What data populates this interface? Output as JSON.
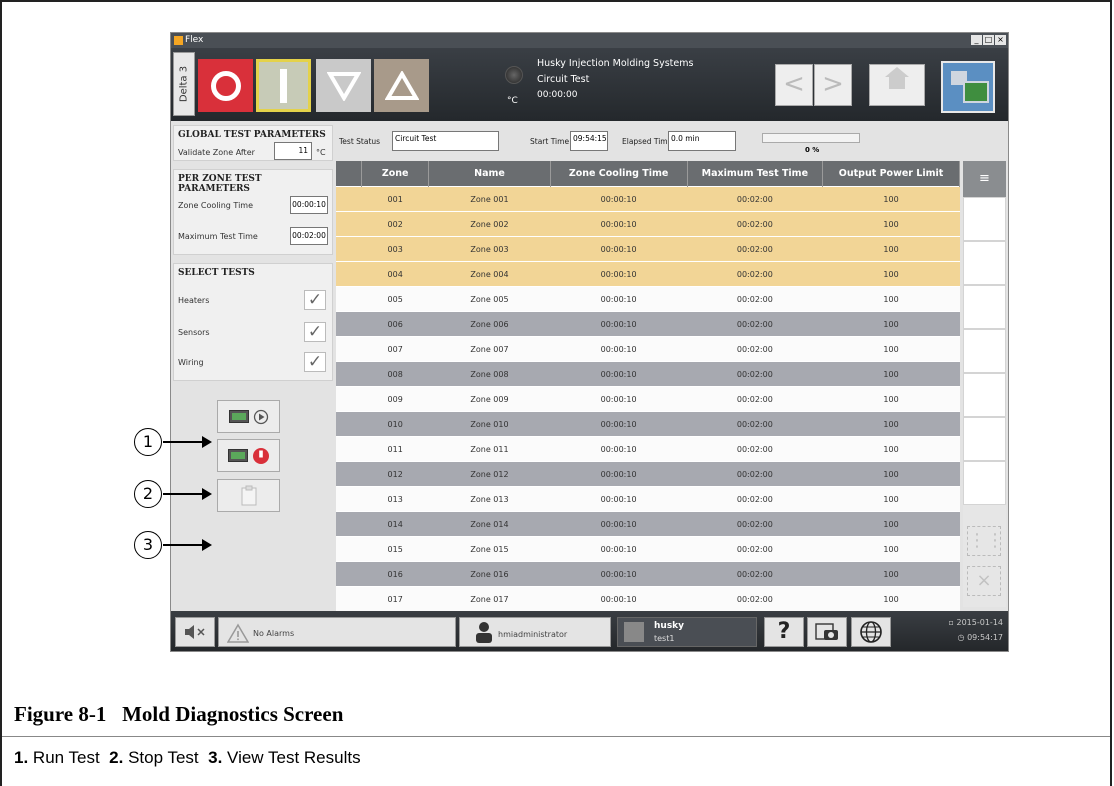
{
  "window": {
    "title": "Flex",
    "controls": [
      "_",
      "□",
      "×"
    ]
  },
  "toolbar": {
    "side_label": "Delta 3",
    "info": {
      "line1": "Husky Injection Molding Systems",
      "line2": "Circuit Test",
      "line3": "00:00:00",
      "temp_unit": "°C"
    },
    "nav_prev": "<",
    "nav_next": ">"
  },
  "global": {
    "title": "GLOBAL TEST PARAMETERS",
    "validate_label": "Validate Zone After",
    "validate_value": "11",
    "validate_unit": "°C"
  },
  "per_zone": {
    "title": "PER ZONE TEST PARAMETERS",
    "cooling_label": "Zone Cooling Time",
    "cooling_value": "00:00:10",
    "max_label": "Maximum Test Time",
    "max_value": "00:02:00"
  },
  "select_tests": {
    "title": "SELECT TESTS",
    "heaters": "Heaters",
    "sensors": "Sensors",
    "wiring": "Wiring",
    "check_glyph": "✓"
  },
  "status": {
    "test_status_label": "Test Status",
    "test_status_value": "Circuit Test",
    "start_label": "Start Time",
    "start_value": "09:54:15",
    "elapsed_label": "Elapsed Time",
    "elapsed_value": "0.0 min",
    "progress_text": "0 %",
    "progress_fraction": 0
  },
  "table": {
    "headers": [
      "Zone",
      "Name",
      "Zone Cooling Time",
      "Maximum Test Time",
      "Output Power Limit"
    ],
    "rows": [
      [
        "001",
        "Zone 001",
        "00:00:10",
        "00:02:00",
        "100"
      ],
      [
        "002",
        "Zone 002",
        "00:00:10",
        "00:02:00",
        "100"
      ],
      [
        "003",
        "Zone 003",
        "00:00:10",
        "00:02:00",
        "100"
      ],
      [
        "004",
        "Zone 004",
        "00:00:10",
        "00:02:00",
        "100"
      ],
      [
        "005",
        "Zone 005",
        "00:00:10",
        "00:02:00",
        "100"
      ],
      [
        "006",
        "Zone 006",
        "00:00:10",
        "00:02:00",
        "100"
      ],
      [
        "007",
        "Zone 007",
        "00:00:10",
        "00:02:00",
        "100"
      ],
      [
        "008",
        "Zone 008",
        "00:00:10",
        "00:02:00",
        "100"
      ],
      [
        "009",
        "Zone 009",
        "00:00:10",
        "00:02:00",
        "100"
      ],
      [
        "010",
        "Zone 010",
        "00:00:10",
        "00:02:00",
        "100"
      ],
      [
        "011",
        "Zone 011",
        "00:00:10",
        "00:02:00",
        "100"
      ],
      [
        "012",
        "Zone 012",
        "00:00:10",
        "00:02:00",
        "100"
      ],
      [
        "013",
        "Zone 013",
        "00:00:10",
        "00:02:00",
        "100"
      ],
      [
        "014",
        "Zone 014",
        "00:00:10",
        "00:02:00",
        "100"
      ],
      [
        "015",
        "Zone 015",
        "00:00:10",
        "00:02:00",
        "100"
      ],
      [
        "016",
        "Zone 016",
        "00:00:10",
        "00:02:00",
        "100"
      ],
      [
        "017",
        "Zone 017",
        "00:00:10",
        "00:02:00",
        "100"
      ]
    ],
    "menu_glyph": "≡"
  },
  "footer": {
    "alarms": "No Alarms",
    "user": "hmiadministrator",
    "mold_name": "husky",
    "mold_sub": "test1",
    "help": "?",
    "date": "2015-01-14",
    "time": "09:54:17"
  },
  "callouts": [
    "1",
    "2",
    "3"
  ],
  "caption": {
    "figure": "Figure 8-1",
    "title": "Mold Diagnostics Screen",
    "items": [
      {
        "num": "1.",
        "label": "Run Test"
      },
      {
        "num": "2.",
        "label": "Stop Test"
      },
      {
        "num": "3.",
        "label": "View Test Results"
      }
    ]
  },
  "colors": {
    "off": "#d9303a",
    "highlight_row": "#f2d596",
    "alt_row": "#a7a9b0",
    "accent": "#5b8fc2"
  },
  "icons": [
    "mute-icon",
    "alarm-warning-icon",
    "user-icon",
    "mold-icon",
    "help-icon",
    "screenshot-icon",
    "globe-icon",
    "calendar-icon",
    "clock-icon",
    "home-icon",
    "diagnostics-icon",
    "run-icon",
    "stop-icon",
    "results-icon"
  ]
}
